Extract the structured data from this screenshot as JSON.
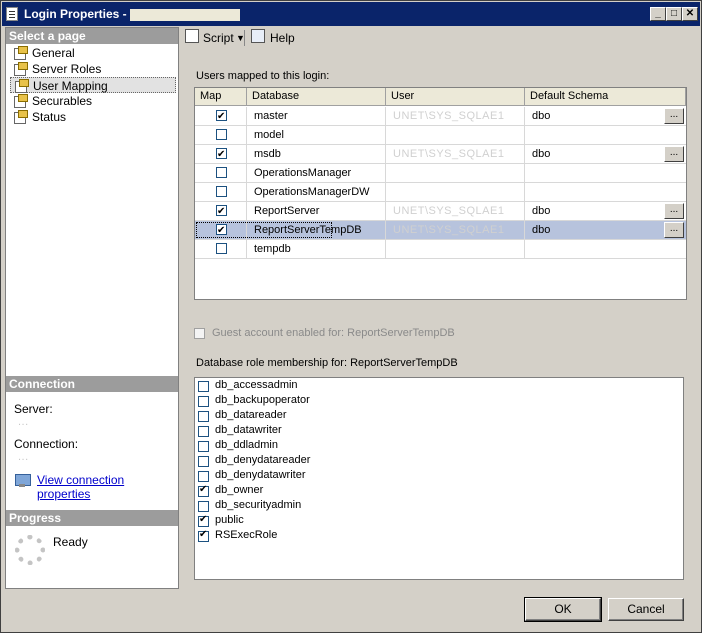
{
  "window": {
    "title": "Login Properties -",
    "controls": {
      "minimize": "_",
      "maximize": "□",
      "close": "✕"
    }
  },
  "left": {
    "select_page_header": "Select a page",
    "pages": [
      {
        "label": "General",
        "icon": "page-icon"
      },
      {
        "label": "Server Roles",
        "icon": "page-icon"
      },
      {
        "label": "User Mapping",
        "icon": "page-icon",
        "selected": true
      },
      {
        "label": "Securables",
        "icon": "page-icon"
      },
      {
        "label": "Status",
        "icon": "page-icon"
      }
    ],
    "connection_header": "Connection",
    "server_label": "Server:",
    "server_value": "...",
    "connection_label": "Connection:",
    "connection_value": "...",
    "view_connection_link": "View connection properties",
    "progress_header": "Progress",
    "progress_status": "Ready"
  },
  "toolbar": {
    "script_label": "Script",
    "help_label": "Help"
  },
  "mapping": {
    "section_label": "Users mapped to this login:",
    "columns": [
      "Map",
      "Database",
      "User",
      "Default Schema"
    ],
    "rows": [
      {
        "checked": true,
        "database": "master",
        "user": "UNET\\SYS_SQLAE1",
        "schema": "dbo",
        "has_button": true
      },
      {
        "checked": false,
        "database": "model",
        "user": "",
        "schema": "",
        "has_button": false
      },
      {
        "checked": true,
        "database": "msdb",
        "user": "UNET\\SYS_SQLAE1",
        "schema": "dbo",
        "has_button": true
      },
      {
        "checked": false,
        "database": "OperationsManager",
        "user": "",
        "schema": "",
        "has_button": false
      },
      {
        "checked": false,
        "database": "OperationsManagerDW",
        "user": "",
        "schema": "",
        "has_button": false
      },
      {
        "checked": true,
        "database": "ReportServer",
        "user": "UNET\\SYS_SQLAE1",
        "schema": "dbo",
        "has_button": true
      },
      {
        "checked": true,
        "database": "ReportServerTempDB",
        "user": "UNET\\SYS_SQLAE1",
        "schema": "dbo",
        "has_button": true,
        "selected": true
      },
      {
        "checked": false,
        "database": "tempdb",
        "user": "",
        "schema": "",
        "has_button": false
      }
    ],
    "ellipsis": "...",
    "guest_label": "Guest account enabled for: ReportServerTempDB",
    "guest_checked": false
  },
  "roles": {
    "section_label": "Database role membership for: ReportServerTempDB",
    "items": [
      {
        "name": "db_accessadmin",
        "checked": false
      },
      {
        "name": "db_backupoperator",
        "checked": false
      },
      {
        "name": "db_datareader",
        "checked": false
      },
      {
        "name": "db_datawriter",
        "checked": false
      },
      {
        "name": "db_ddladmin",
        "checked": false
      },
      {
        "name": "db_denydatareader",
        "checked": false
      },
      {
        "name": "db_denydatawriter",
        "checked": false
      },
      {
        "name": "db_owner",
        "checked": true
      },
      {
        "name": "db_securityadmin",
        "checked": false
      },
      {
        "name": "public",
        "checked": true
      },
      {
        "name": "RSExecRole",
        "checked": true
      }
    ]
  },
  "buttons": {
    "ok": "OK",
    "cancel": "Cancel"
  },
  "colors": {
    "titlebar": "#0a246a",
    "selected_row": "#b7c3dd",
    "section_header": "#9c9c9c",
    "link": "#0000cc"
  }
}
